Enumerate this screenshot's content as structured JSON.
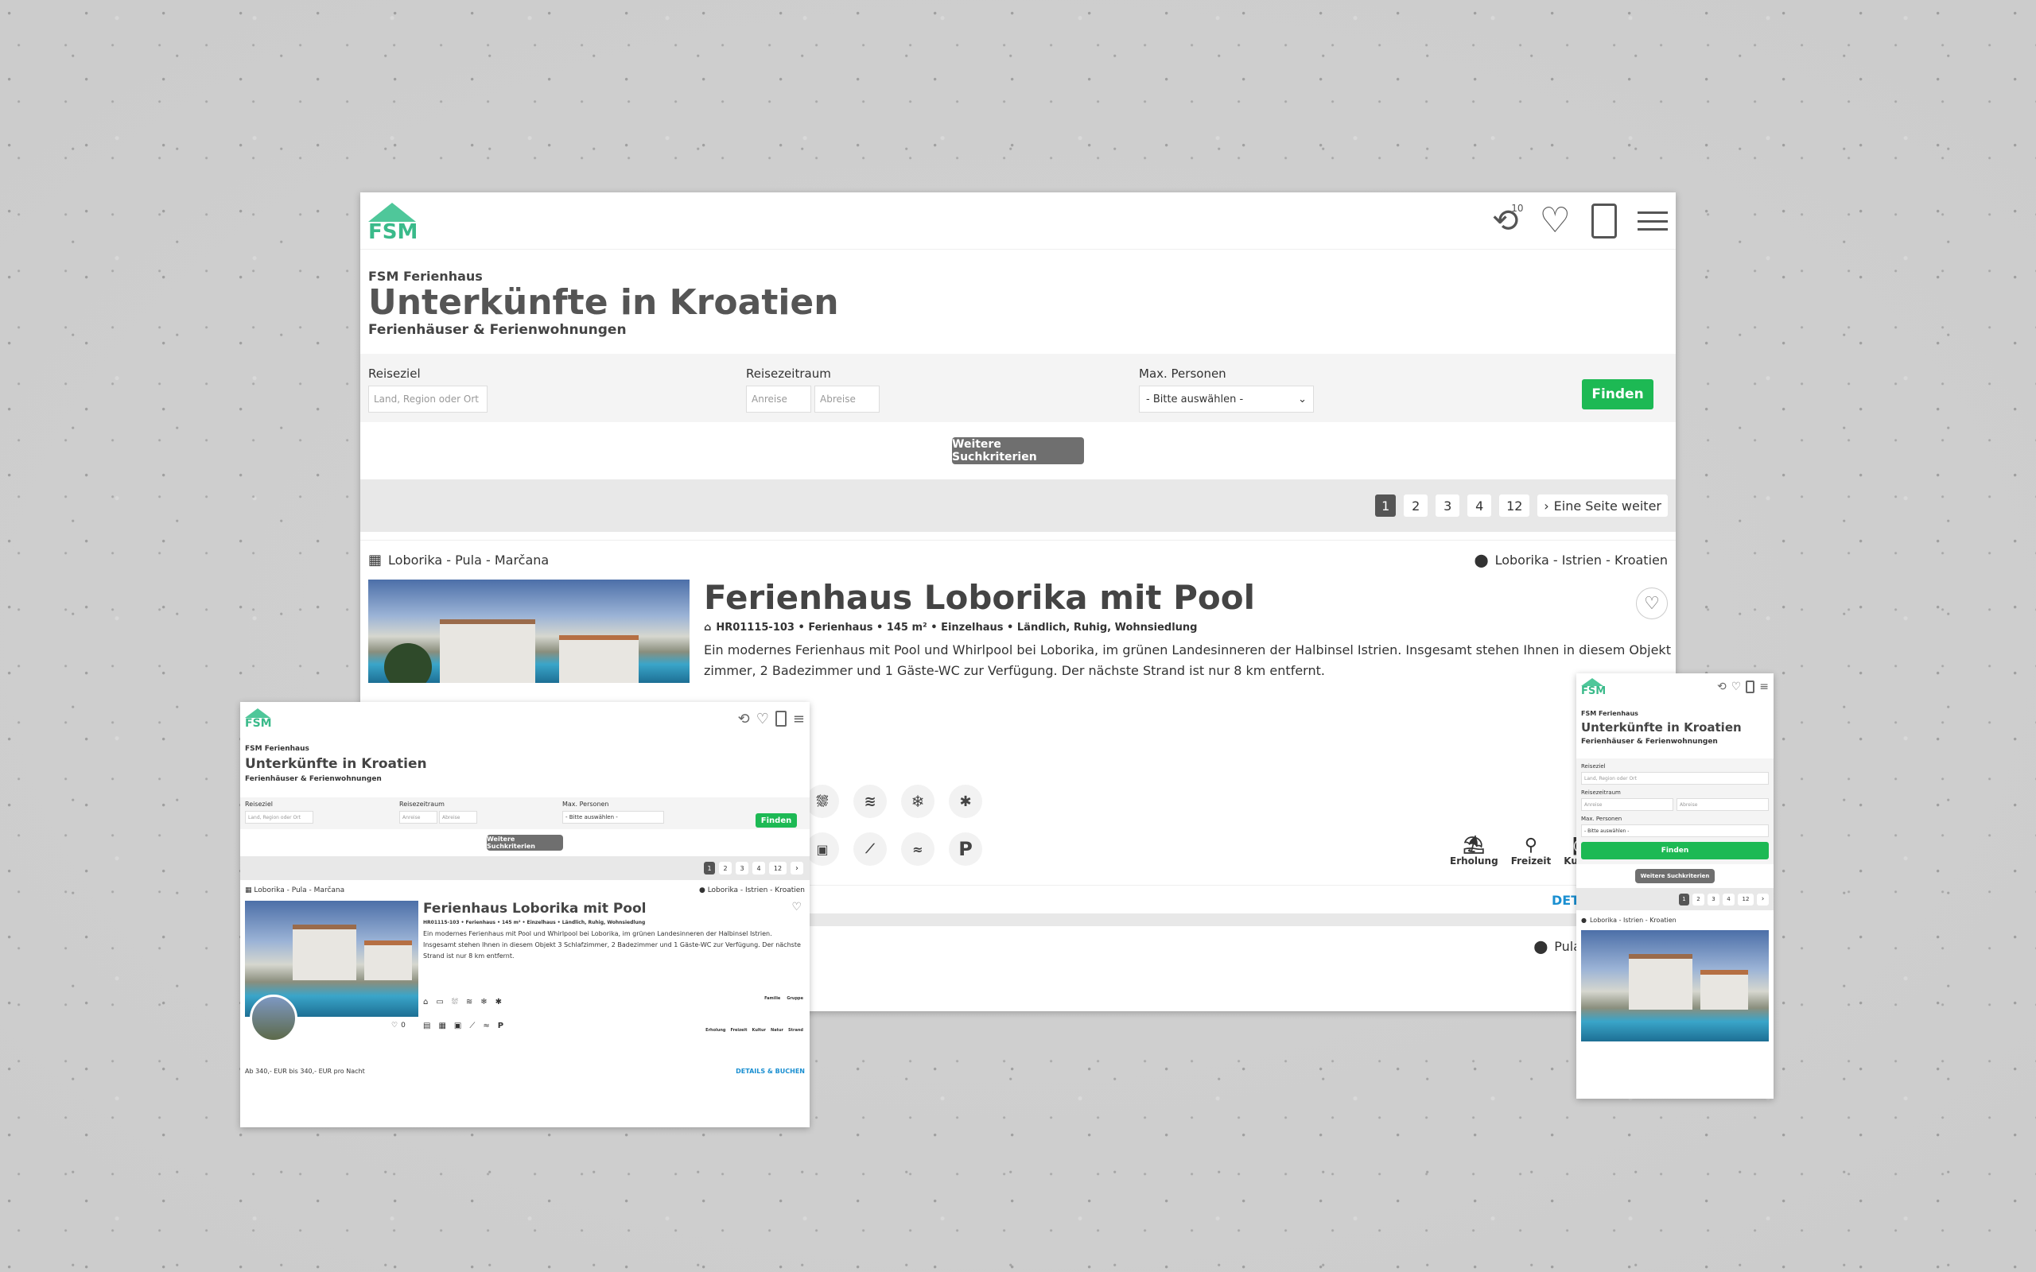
{
  "brand": {
    "logo_text": "FSM",
    "accent": "#4fc79a",
    "green": "#1db954"
  },
  "header": {
    "history_count": "10",
    "icons": [
      "history-icon",
      "heart-icon",
      "bag-icon",
      "menu-icon"
    ]
  },
  "hero": {
    "eyebrow": "FSM Ferienhaus",
    "title": "Unterkünfte in Kroatien",
    "subtitle": "Ferienhäuser & Ferienwohnungen"
  },
  "search": {
    "destination_label": "Reiseziel",
    "destination_placeholder": "Land, Region oder Ort",
    "period_label": "Reisezeitraum",
    "arrival_placeholder": "Anreise",
    "departure_placeholder": "Abreise",
    "persons_label": "Max. Personen",
    "persons_value": "- Bitte auswählen -",
    "find_label": "Finden",
    "more_criteria_label": "Weitere Suchkriterien"
  },
  "pagination": {
    "pages": [
      "1",
      "2",
      "3",
      "4",
      "12"
    ],
    "active": "1",
    "next_label": "Eine Seite weiter"
  },
  "listing": {
    "area": "Loborika - Pula - Marčana",
    "location": "Loborika - Istrien - Kroatien",
    "title": "Ferienhaus Loborika mit Pool",
    "meta": "HR01115-103 • Ferienhaus • 145 m² • Einzelhaus • Ländlich, Ruhig, Wohnsiedlung",
    "description": "Ein modernes Ferienhaus mit Pool und Whirlpool bei Loborika, im grünen Landesinneren der Halbinsel Istrien. Insgesamt stehen Ihnen in diesem Objekt 3 Schlafzimmer, 2 Badezimmer und 1 Gäste-WC zur Verfügung. Der nächste Strand ist nur 8 km entfernt.",
    "description_line1": "Ein modernes Ferienhaus mit Pool und Whirlpool bei Loborika, im grünen Landesinneren der Halbinsel Istrien. Insgesamt stehen Ihnen in diesem Objekt 3 Schlaf-",
    "description_line2": "zimmer, 2 Badezimmer und 1 Gäste-WC zur Verfügung. Der nächste Strand ist nur 8 km entfernt.",
    "feature_row1": [
      "2",
      "",
      "",
      ""
    ],
    "feature_row2": [
      "",
      "",
      "",
      "2"
    ],
    "categories": [
      "Erholung",
      "Freizeit",
      "Kultur",
      "Natur",
      "Strand",
      "Familie",
      "Gruppe"
    ],
    "details_label": "DETAILS & BUCHEN",
    "details_partial": "DET",
    "price": "Ab 340,- EUR bis 340,- EUR pro Nacht",
    "like_count": "0"
  },
  "next_listing": {
    "location_partial": "Pula - Is"
  }
}
